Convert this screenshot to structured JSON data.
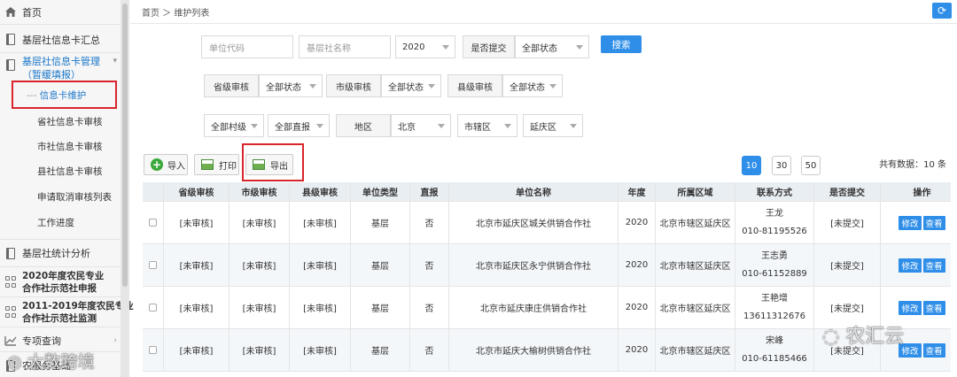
{
  "sidebar": {
    "home": "首页",
    "summary": "基层社信息卡汇总",
    "card_mgmt_line1": "基层社信息卡管理",
    "card_mgmt_line2": "（暂缓填报）",
    "subitems": [
      "信息卡维护",
      "省社信息卡审核",
      "市社信息卡审核",
      "县社信息卡审核",
      "申请取消审核列表",
      "工作进度"
    ],
    "stats": "基层社统计分析",
    "demo2020_line1": "2020年度农民专业",
    "demo2020_line2": "合作社示范社申报",
    "demo2011_line1": "2011-2019年度农民专业",
    "demo2011_line2": "合作社示范社监测",
    "special_query": "专项查询",
    "last_item": "农服务基础"
  },
  "breadcrumb": "首页 ＞ 维护列表",
  "filters": {
    "unit_code_placeholder": "单位代码",
    "coop_name_placeholder": "基层社名称",
    "year": "2020",
    "submitted_label": "是否提交",
    "submitted_value": "全部状态",
    "search_button": "搜索",
    "prov_label": "省级审核",
    "prov_value": "全部状态",
    "city_label": "市级审核",
    "city_value": "全部状态",
    "county_label": "县级审核",
    "county_value": "全部状态",
    "village": "全部村级",
    "direct": "全部直报",
    "region_label": "地区",
    "region_prov": "北京",
    "region_city": "市辖区",
    "region_county": "延庆区"
  },
  "toolbar": {
    "import": "导入",
    "print": "打印",
    "export": "导出"
  },
  "pagination": {
    "sizes": [
      "10",
      "30",
      "50"
    ],
    "active": "10",
    "total": "共有数据：10 条"
  },
  "table": {
    "headers": [
      "省级审核",
      "市级审核",
      "县级审核",
      "单位类型",
      "直报",
      "单位名称",
      "年度",
      "所属区域",
      "联系方式",
      "是否提交",
      "操作"
    ],
    "rows": [
      {
        "prov": "[未审核]",
        "city": "[未审核]",
        "county": "[未审核]",
        "type": "基层",
        "direct": "否",
        "name": "北京市延庆区城关供销合作社",
        "year": "2020",
        "region": "北京市辖区延庆区",
        "contact_name": "王龙",
        "contact_phone": "010-81195526",
        "submitted": "[未提交]"
      },
      {
        "prov": "[未审核]",
        "city": "[未审核]",
        "county": "[未审核]",
        "type": "基层",
        "direct": "否",
        "name": "北京市延庆区永宁供销合作社",
        "year": "2020",
        "region": "北京市辖区延庆区",
        "contact_name": "王志勇",
        "contact_phone": "010-61152889",
        "submitted": "[未提交]"
      },
      {
        "prov": "[未审核]",
        "city": "[未审核]",
        "county": "[未审核]",
        "type": "基层",
        "direct": "否",
        "name": "北京市延庆康庄供销合作社",
        "year": "2020",
        "region": "北京市辖区延庆区",
        "contact_name": "王艳增",
        "contact_phone": "13611312676",
        "submitted": "[未提交]"
      },
      {
        "prov": "[未审核]",
        "city": "[未审核]",
        "county": "[未审核]",
        "type": "基层",
        "direct": "否",
        "name": "北京市延庆大榆树供销合作社",
        "year": "2020",
        "region": "北京市辖区延庆区",
        "contact_name": "宋峰",
        "contact_phone": "010-61185466",
        "submitted": "[未提交]"
      }
    ],
    "edit": "修改",
    "view": "查看"
  },
  "watermarks": {
    "left": "大数跨境",
    "right": "农汇云"
  },
  "colors": {
    "accent": "#2f8ee8",
    "highlight": "#d9262b"
  }
}
